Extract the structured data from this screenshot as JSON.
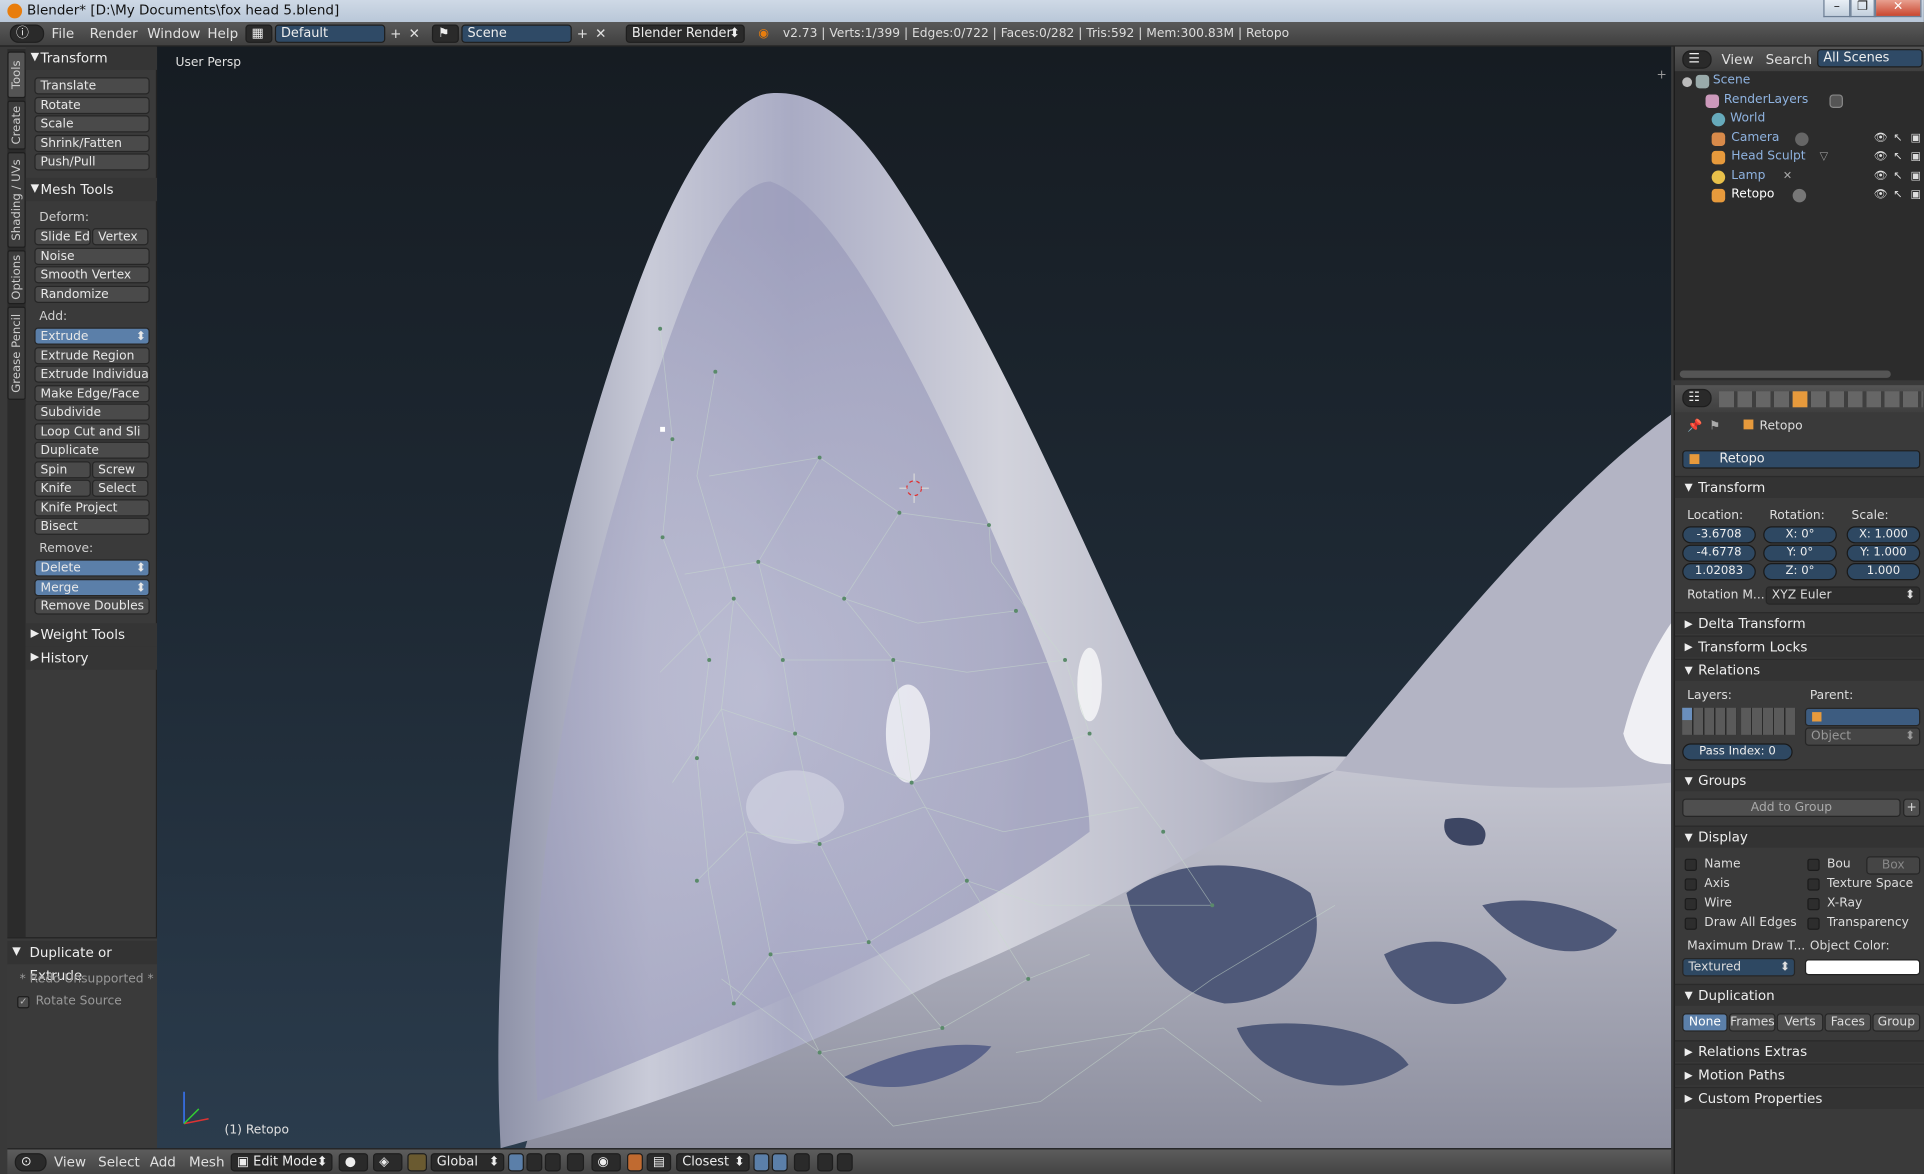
{
  "titlebar": {
    "title": "Blender* [D:\\My Documents\\fox head 5.blend]",
    "min": "–",
    "max": "❐",
    "close": "✕"
  },
  "infobar": {
    "menus": [
      "File",
      "Render",
      "Window",
      "Help"
    ],
    "screen_layout": "Default",
    "scene": "Scene",
    "engine": "Blender Render",
    "stats": "v2.73 | Verts:1/399 | Edges:0/722 | Faces:0/282 | Tris:592 | Mem:300.83M | Retopo"
  },
  "toolshelf": {
    "tabs": [
      "Tools",
      "Create",
      "Shading / UVs",
      "Options",
      "Grease Pencil"
    ],
    "transform_header": "Transform",
    "transform_buttons": [
      "Translate",
      "Rotate",
      "Scale",
      "Shrink/Fatten",
      "Push/Pull"
    ],
    "mesh_tools_header": "Mesh Tools",
    "deform_label": "Deform:",
    "slide_edge": "Slide Ed",
    "vertex": "Vertex",
    "noise": "Noise",
    "smooth_vertex": "Smooth Vertex",
    "randomize": "Randomize",
    "add_label": "Add:",
    "extrude": "Extrude",
    "extrude_region": "Extrude Region",
    "extrude_individual": "Extrude Individual",
    "make_edge_face": "Make Edge/Face",
    "subdivide": "Subdivide",
    "loop_cut": "Loop Cut and Sli",
    "duplicate": "Duplicate",
    "spin": "Spin",
    "screw": "Screw",
    "knife": "Knife",
    "select": "Select",
    "knife_project": "Knife Project",
    "bisect": "Bisect",
    "remove_label": "Remove:",
    "delete": "Delete",
    "merge": "Merge",
    "remove_doubles": "Remove Doubles",
    "weight_tools": "Weight Tools",
    "history": "History"
  },
  "redo_panel": {
    "header": "Duplicate or Extrude",
    "note": "* Redo Unsupported *",
    "rotate_source": "Rotate Source"
  },
  "viewport": {
    "label": "User Persp",
    "object_label": "(1) Retopo"
  },
  "bottombar": {
    "menus": [
      "View",
      "Select",
      "Add",
      "Mesh"
    ],
    "mode": "Edit Mode",
    "orientation": "Global",
    "snap": "Closest"
  },
  "outliner": {
    "menus": [
      "View",
      "Search"
    ],
    "display_mode": "All Scenes",
    "items": [
      {
        "name": "Scene",
        "icon": "scene-icon"
      },
      {
        "name": "RenderLayers",
        "icon": "renderlayers-icon"
      },
      {
        "name": "World",
        "icon": "world-icon"
      },
      {
        "name": "Camera",
        "icon": "camera-icon"
      },
      {
        "name": "Head Sculpt",
        "icon": "mesh-icon"
      },
      {
        "name": "Lamp",
        "icon": "lamp-icon"
      },
      {
        "name": "Retopo",
        "icon": "mesh-icon"
      }
    ]
  },
  "properties": {
    "breadcrumb": "Retopo",
    "object_name": "Retopo",
    "transform_header": "Transform",
    "location_label": "Location:",
    "rotation_label": "Rotation:",
    "scale_label": "Scale:",
    "location": [
      "-3.6708",
      "-4.6778",
      "1.02083"
    ],
    "rotation": [
      "X:",
      "0°",
      "Y:",
      "0°",
      "Z:",
      "0°"
    ],
    "scale": [
      "X: 1.000",
      "Y: 1.000",
      "1.000"
    ],
    "rotation_mode_label": "Rotation M...",
    "rotation_mode": "XYZ Euler",
    "delta_transform": "Delta Transform",
    "transform_locks": "Transform Locks",
    "relations": "Relations",
    "layers_label": "Layers:",
    "parent_label": "Parent:",
    "parent_type": "Object",
    "pass_index": "Pass Index:",
    "pass_index_value": "0",
    "groups": "Groups",
    "add_to_group": "Add to Group",
    "display": "Display",
    "display_name": "Name",
    "display_bou": "Bou",
    "display_box": "Box",
    "display_axis": "Axis",
    "display_texture_space": "Texture Space",
    "display_wire": "Wire",
    "display_xray": "X-Ray",
    "display_all_edges": "Draw All Edges",
    "display_transparency": "Transparency",
    "max_draw_label": "Maximum Draw T...",
    "object_color_label": "Object Color:",
    "max_draw": "Textured",
    "duplication": "Duplication",
    "dup_options": [
      "None",
      "Frames",
      "Verts",
      "Faces",
      "Group"
    ],
    "relations_extras": "Relations Extras",
    "motion_paths": "Motion Paths",
    "custom_properties": "Custom Properties"
  },
  "colors": {
    "accent": "#5b7fa9",
    "field": "#2e4862",
    "mesh": "#b8bccd"
  }
}
